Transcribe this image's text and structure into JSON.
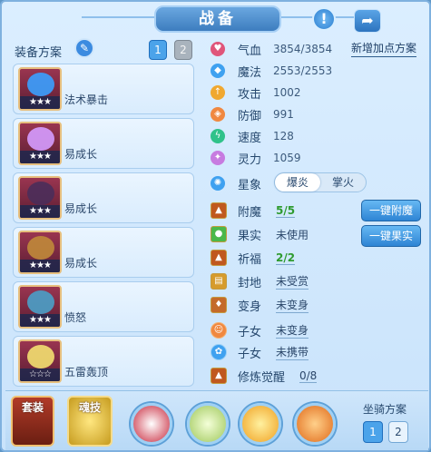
{
  "header": {
    "title": "战备",
    "hint_icon": "exclamation-icon",
    "share_icon": "share-icon"
  },
  "equipment_plan": {
    "label": "装备方案",
    "tabs": [
      "1",
      "2"
    ],
    "active_tab": "1"
  },
  "equipment": [
    {
      "name": "法术暴击",
      "stars": "★★★",
      "color": "#3aa0ff"
    },
    {
      "name": "易成长",
      "stars": "★★★",
      "color": "#d59cff"
    },
    {
      "name": "易成长",
      "stars": "★★★",
      "color": "#4a2e5a"
    },
    {
      "name": "易成长",
      "stars": "★★★",
      "color": "#c08a3a"
    },
    {
      "name": "愤怒",
      "stars": "★★★",
      "color": "#4aa0c8"
    },
    {
      "name": "五雷轰顶",
      "stars": "☆☆☆",
      "color": "#f3e070"
    }
  ],
  "stats": [
    {
      "label": "气血",
      "value": "3854/3854",
      "icon": "heart-icon",
      "color": "#e0557a"
    },
    {
      "label": "魔法",
      "value": "2553/2553",
      "icon": "diamond-icon",
      "color": "#3fa1f0"
    },
    {
      "label": "攻击",
      "value": "1002",
      "icon": "sword-icon",
      "color": "#f0a830"
    },
    {
      "label": "防御",
      "value": "991",
      "icon": "shield-icon",
      "color": "#f08840"
    },
    {
      "label": "速度",
      "value": "128",
      "icon": "lightning-icon",
      "color": "#2fc28a"
    },
    {
      "label": "灵力",
      "value": "1059",
      "icon": "spirit-icon",
      "color": "#c77be0"
    }
  ],
  "new_plan_button": "新增加点方案",
  "zodiac": {
    "label": "星象",
    "options": [
      "爆炎",
      "掌火"
    ],
    "selected": "爆炎"
  },
  "items": [
    {
      "label": "附魔",
      "value": "5/5",
      "green": true,
      "icon": "enchant-icon",
      "color": "#c0581e"
    },
    {
      "label": "果实",
      "value": "未使用",
      "green": false,
      "icon": "fruit-icon",
      "color": "#4bb84b"
    },
    {
      "label": "祈福",
      "value": "2/2",
      "green": true,
      "icon": "blessing-icon",
      "color": "#c0581e"
    },
    {
      "label": "封地",
      "value": "未受赏",
      "green": false,
      "icon": "land-icon",
      "color": "#d69b2c"
    },
    {
      "label": "变身",
      "value": "未变身",
      "green": false,
      "icon": "transform-icon",
      "color": "#c46a2a"
    },
    {
      "label": "子女",
      "value": "未变身",
      "green": false,
      "icon": "child-icon",
      "color": "#f08840"
    },
    {
      "label": "子女",
      "value": "未携带",
      "green": false,
      "icon": "paw-icon",
      "color": "#3fa1f0"
    },
    {
      "label": "修炼觉醒",
      "value": "0/8",
      "green": false,
      "icon": "awaken-icon",
      "color": "#c0581e"
    }
  ],
  "actions": {
    "enchant": "一键附魔",
    "fruit": "一键果实"
  },
  "bottom_tabs": {
    "suit": "套装",
    "skill": "魂技"
  },
  "skill_slots": [
    {
      "icon": "blade-fan-icon",
      "color": "#c8283c"
    },
    {
      "icon": "sage-icon",
      "color": "#9ec75a"
    },
    {
      "icon": "fireball-icon",
      "color": "#f0a020"
    },
    {
      "icon": "flame-fist-icon",
      "color": "#e06a1a"
    }
  ],
  "mount_plan": {
    "label": "坐骑方案",
    "tabs": [
      "1",
      "2"
    ],
    "active_tab": "1"
  }
}
